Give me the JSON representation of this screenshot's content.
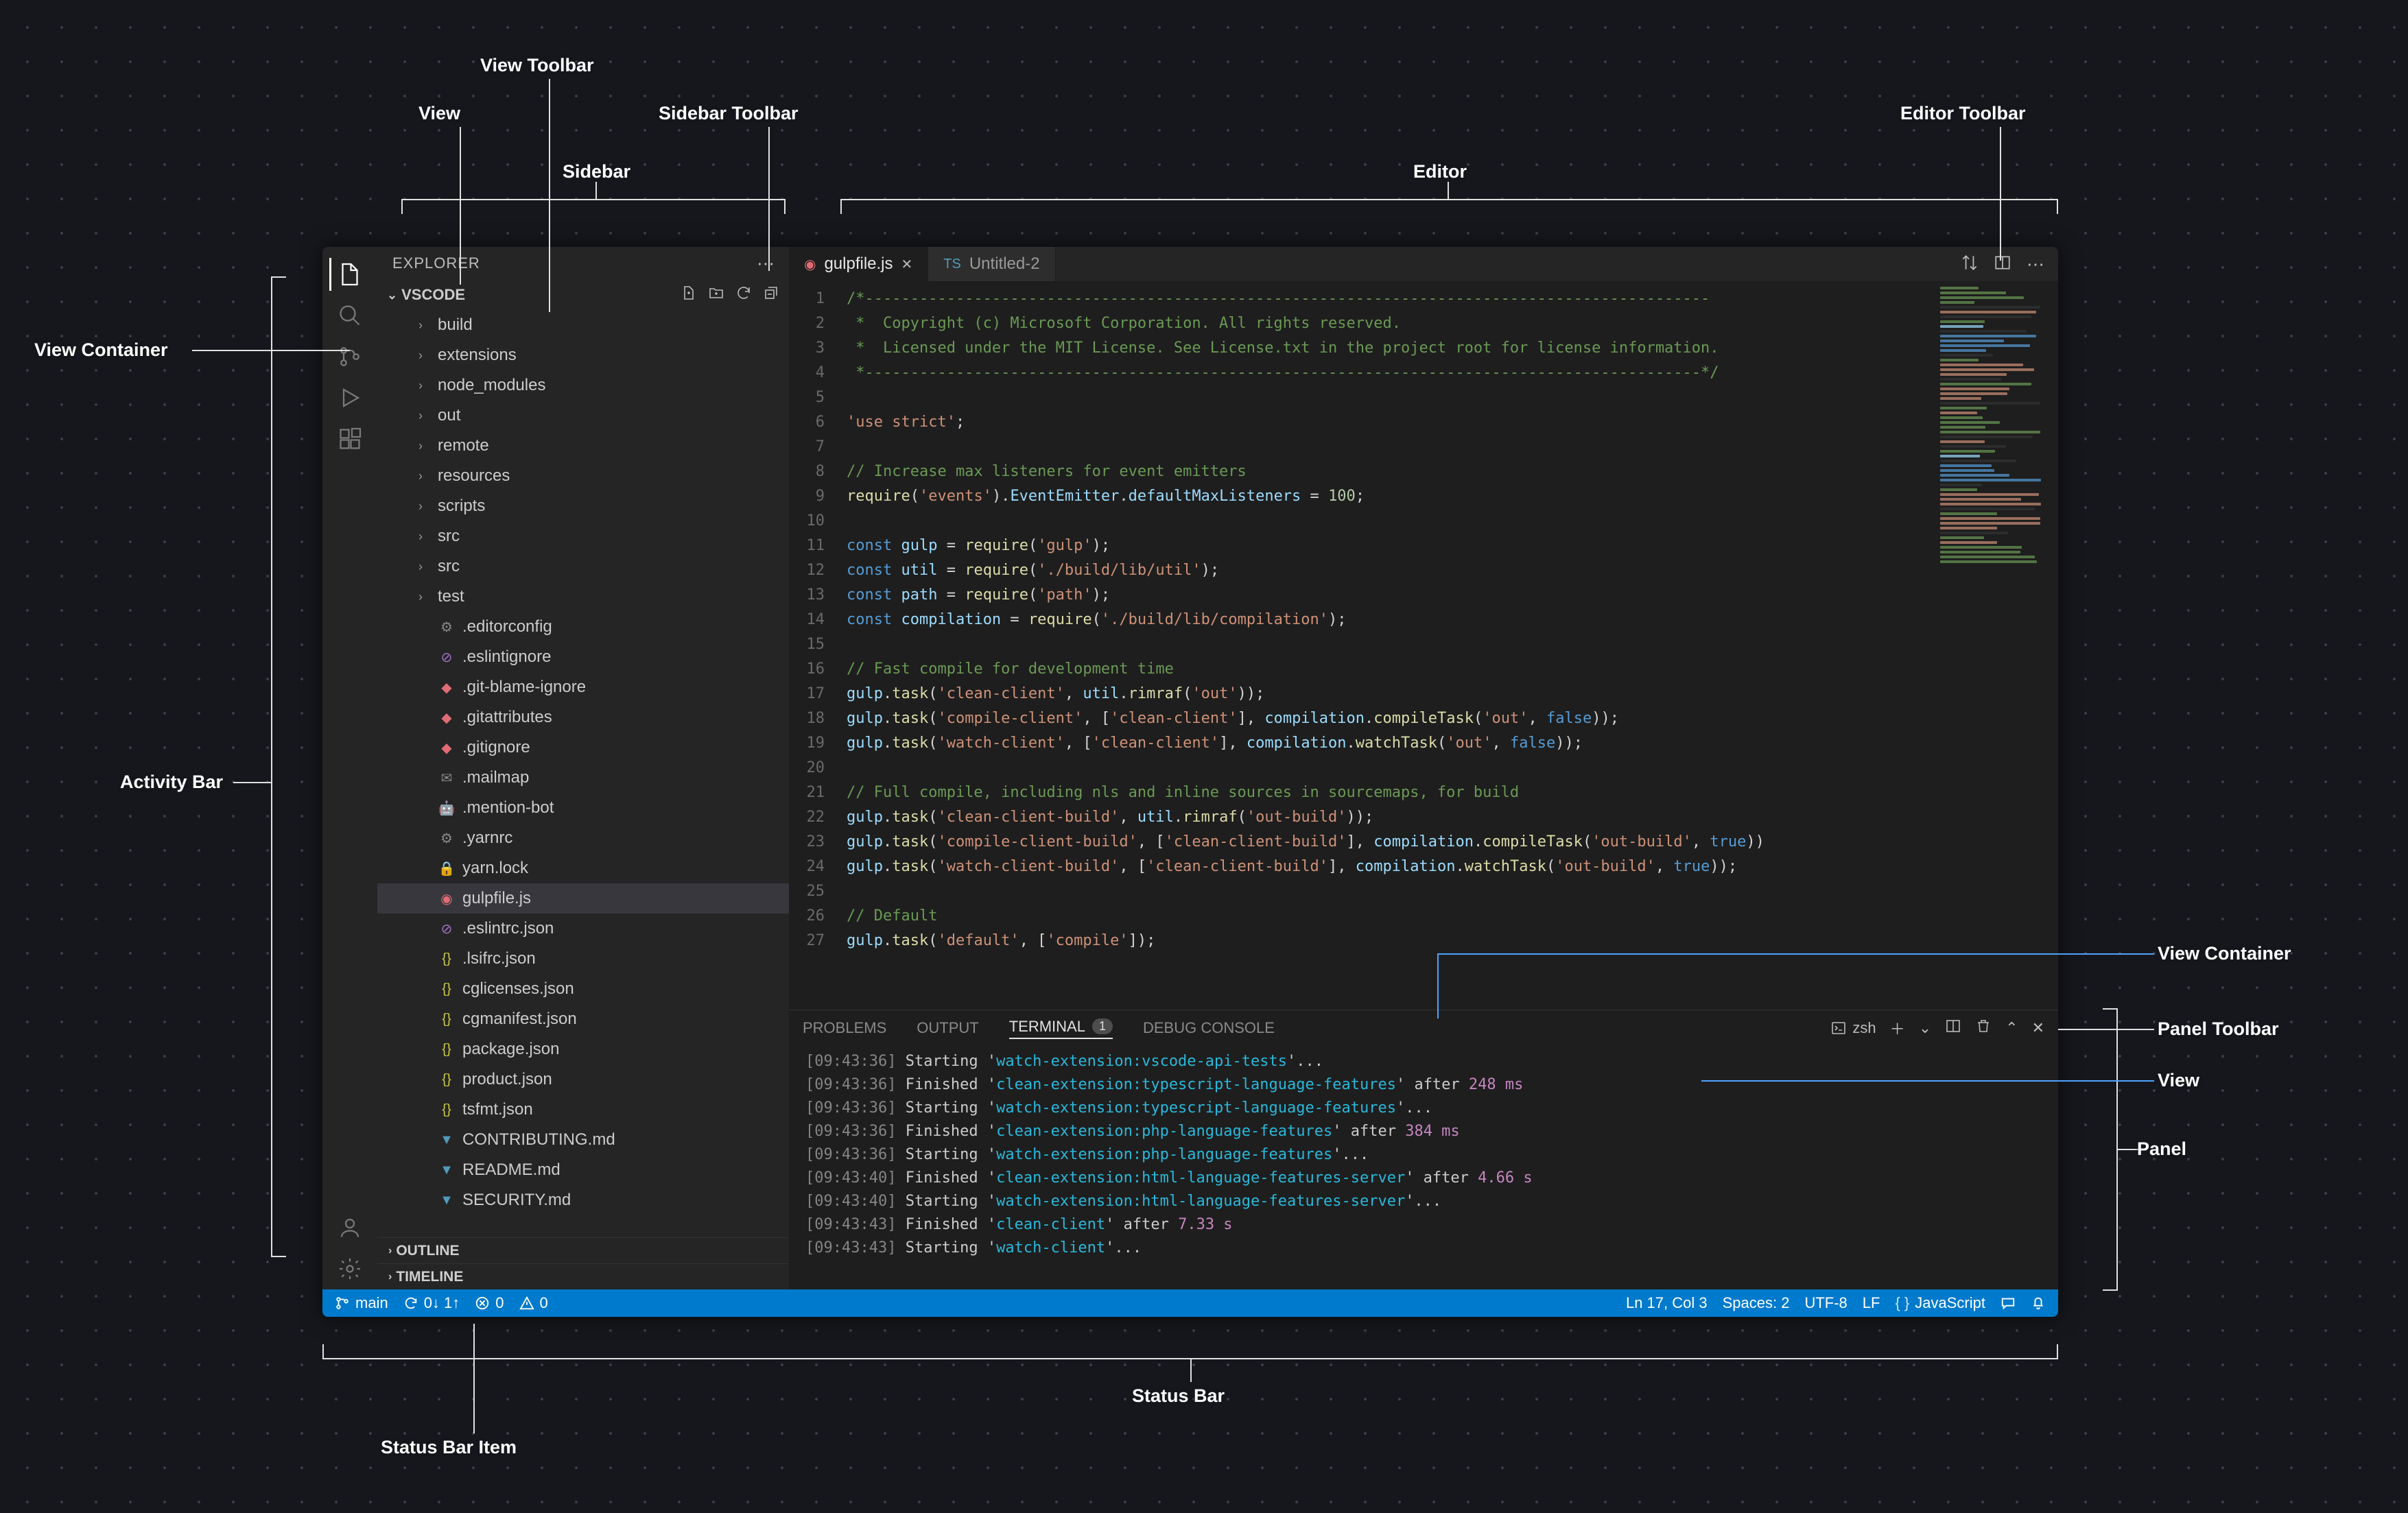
{
  "annotations": {
    "view_toolbar": "View Toolbar",
    "view": "View",
    "sidebar_toolbar": "Sidebar Toolbar",
    "sidebar": "Sidebar",
    "editor": "Editor",
    "editor_toolbar": "Editor Toolbar",
    "view_container_left": "View Container",
    "activity_bar": "Activity Bar",
    "view_container_right": "View Container",
    "panel_toolbar": "Panel Toolbar",
    "view_right": "View",
    "panel": "Panel",
    "status_bar": "Status Bar",
    "status_bar_item": "Status Bar Item"
  },
  "sidebar": {
    "title": "EXPLORER",
    "section": "VSCODE",
    "tree": [
      {
        "t": "folder",
        "label": "build"
      },
      {
        "t": "folder",
        "label": "extensions"
      },
      {
        "t": "folder",
        "label": "node_modules"
      },
      {
        "t": "folder",
        "label": "out"
      },
      {
        "t": "folder",
        "label": "remote"
      },
      {
        "t": "folder",
        "label": "resources"
      },
      {
        "t": "folder",
        "label": "scripts"
      },
      {
        "t": "folder",
        "label": "src"
      },
      {
        "t": "folder",
        "label": "src"
      },
      {
        "t": "folder",
        "label": "test"
      },
      {
        "t": "file",
        "icon": "⚙",
        "cls": "ic-gray",
        "label": ".editorconfig"
      },
      {
        "t": "file",
        "icon": "⊘",
        "cls": "ic-purple",
        "label": ".eslintignore"
      },
      {
        "t": "file",
        "icon": "◆",
        "cls": "ic-red",
        "label": ".git-blame-ignore"
      },
      {
        "t": "file",
        "icon": "◆",
        "cls": "ic-red",
        "label": ".gitattributes"
      },
      {
        "t": "file",
        "icon": "◆",
        "cls": "ic-red",
        "label": ".gitignore"
      },
      {
        "t": "file",
        "icon": "✉",
        "cls": "ic-gray",
        "label": ".mailmap"
      },
      {
        "t": "file",
        "icon": "🤖",
        "cls": "ic-gray",
        "label": ".mention-bot"
      },
      {
        "t": "file",
        "icon": "⚙",
        "cls": "ic-gray",
        "label": ".yarnrc"
      },
      {
        "t": "file",
        "icon": "🔒",
        "cls": "ic-gray",
        "label": "yarn.lock"
      },
      {
        "t": "file",
        "icon": "◉",
        "cls": "ic-red",
        "label": "gulpfile.js",
        "sel": true
      },
      {
        "t": "file",
        "icon": "⊘",
        "cls": "ic-purple",
        "label": ".eslintrc.json"
      },
      {
        "t": "file",
        "icon": "{}",
        "cls": "ic-yellow",
        "label": ".lsifrc.json"
      },
      {
        "t": "file",
        "icon": "{}",
        "cls": "ic-yellow",
        "label": "cglicenses.json"
      },
      {
        "t": "file",
        "icon": "{}",
        "cls": "ic-yellow",
        "label": "cgmanifest.json"
      },
      {
        "t": "file",
        "icon": "{}",
        "cls": "ic-yellow",
        "label": "package.json"
      },
      {
        "t": "file",
        "icon": "{}",
        "cls": "ic-yellow",
        "label": "product.json"
      },
      {
        "t": "file",
        "icon": "{}",
        "cls": "ic-yellow",
        "label": "tsfmt.json"
      },
      {
        "t": "file",
        "icon": "▼",
        "cls": "ic-blue",
        "label": "CONTRIBUTING.md"
      },
      {
        "t": "file",
        "icon": "▼",
        "cls": "ic-blue",
        "label": "README.md"
      },
      {
        "t": "file",
        "icon": "▼",
        "cls": "ic-blue",
        "label": "SECURITY.md"
      }
    ],
    "outline": "OUTLINE",
    "timeline": "TIMELINE"
  },
  "tabs": [
    {
      "icon": "◉",
      "cls": "ic-red",
      "label": "gulpfile.js",
      "active": true,
      "close": true
    },
    {
      "icon": "TS",
      "cls": "ic-blue",
      "label": "Untitled-2",
      "active": false,
      "close": false
    }
  ],
  "code": {
    "lines": [
      "<span class='c-g'>/*---------------------------------------------------------------------------------------------</span>",
      "<span class='c-g'> *  Copyright (c) Microsoft Corporation. All rights reserved.</span>",
      "<span class='c-g'> *  Licensed under the MIT License. See License.txt in the project root for license information.</span>",
      "<span class='c-g'> *--------------------------------------------------------------------------------------------*/</span>",
      "",
      "<span class='c-s'>'use strict'</span>;",
      "",
      "<span class='c-g'>// Increase max listeners for event emitters</span>",
      "<span class='c-f'>require</span>(<span class='c-s'>'events'</span>).<span class='c-v'>EventEmitter</span>.<span class='c-v'>defaultMaxListeners</span> = <span class='c-n'>100</span>;",
      "",
      "<span class='c-k'>const</span> <span class='c-v'>gulp</span> = <span class='c-f'>require</span>(<span class='c-s'>'gulp'</span>);",
      "<span class='c-k'>const</span> <span class='c-v'>util</span> = <span class='c-f'>require</span>(<span class='c-s'>'./build/lib/util'</span>);",
      "<span class='c-k'>const</span> <span class='c-v'>path</span> = <span class='c-f'>require</span>(<span class='c-s'>'path'</span>);",
      "<span class='c-k'>const</span> <span class='c-v'>compilation</span> = <span class='c-f'>require</span>(<span class='c-s'>'./build/lib/compilation'</span>);",
      "",
      "<span class='c-g'>// Fast compile for development time</span>",
      "<span class='c-v'>gulp</span>.<span class='c-f'>task</span>(<span class='c-s'>'clean-client'</span>, <span class='c-v'>util</span>.<span class='c-f'>rimraf</span>(<span class='c-s'>'out'</span>));",
      "<span class='c-v'>gulp</span>.<span class='c-f'>task</span>(<span class='c-s'>'compile-client'</span>, [<span class='c-s'>'clean-client'</span>], <span class='c-v'>compilation</span>.<span class='c-f'>compileTask</span>(<span class='c-s'>'out'</span>, <span class='c-k'>false</span>));",
      "<span class='c-v'>gulp</span>.<span class='c-f'>task</span>(<span class='c-s'>'watch-client'</span>, [<span class='c-s'>'clean-client'</span>], <span class='c-v'>compilation</span>.<span class='c-f'>watchTask</span>(<span class='c-s'>'out'</span>, <span class='c-k'>false</span>));",
      "",
      "<span class='c-g'>// Full compile, including nls and inline sources in sourcemaps, for build</span>",
      "<span class='c-v'>gulp</span>.<span class='c-f'>task</span>(<span class='c-s'>'clean-client-build'</span>, <span class='c-v'>util</span>.<span class='c-f'>rimraf</span>(<span class='c-s'>'out-build'</span>));",
      "<span class='c-v'>gulp</span>.<span class='c-f'>task</span>(<span class='c-s'>'compile-client-build'</span>, [<span class='c-s'>'clean-client-build'</span>], <span class='c-v'>compilation</span>.<span class='c-f'>compileTask</span>(<span class='c-s'>'out-build'</span>, <span class='c-k'>true</span>))",
      "<span class='c-v'>gulp</span>.<span class='c-f'>task</span>(<span class='c-s'>'watch-client-build'</span>, [<span class='c-s'>'clean-client-build'</span>], <span class='c-v'>compilation</span>.<span class='c-f'>watchTask</span>(<span class='c-s'>'out-build'</span>, <span class='c-k'>true</span>));",
      "",
      "<span class='c-g'>// Default</span>",
      "<span class='c-v'>gulp</span>.<span class='c-f'>task</span>(<span class='c-s'>'default'</span>, [<span class='c-s'>'compile'</span>]);"
    ]
  },
  "panel": {
    "tabs": {
      "problems": "PROBLEMS",
      "output": "OUTPUT",
      "terminal": "TERMINAL",
      "debug": "DEBUG CONSOLE",
      "badge": "1"
    },
    "shell": "zsh",
    "lines": [
      "<span class='t-gray'>[09:43:36]</span> Starting '<span class='t-cyan'>watch-extension:vscode-api-tests</span>'...",
      "<span class='t-gray'>[09:43:36]</span> Finished '<span class='t-cyan'>clean-extension:typescript-language-features</span>' after <span class='t-mag'>248 ms</span>",
      "<span class='t-gray'>[09:43:36]</span> Starting '<span class='t-cyan'>watch-extension:typescript-language-features</span>'...",
      "<span class='t-gray'>[09:43:36]</span> Finished '<span class='t-cyan'>clean-extension:php-language-features</span>' after <span class='t-mag'>384 ms</span>",
      "<span class='t-gray'>[09:43:36]</span> Starting '<span class='t-cyan'>watch-extension:php-language-features</span>'...",
      "<span class='t-gray'>[09:43:40]</span> Finished '<span class='t-cyan'>clean-extension:html-language-features-server</span>' after <span class='t-mag'>4.66 s</span>",
      "<span class='t-gray'>[09:43:40]</span> Starting '<span class='t-cyan'>watch-extension:html-language-features-server</span>'...",
      "<span class='t-gray'>[09:43:43]</span> Finished '<span class='t-cyan'>clean-client</span>' after <span class='t-mag'>7.33 s</span>",
      "<span class='t-gray'>[09:43:43]</span> Starting '<span class='t-cyan'>watch-client</span>'..."
    ]
  },
  "status": {
    "branch": "main",
    "sync": "0↓ 1↑",
    "errors": "0",
    "warnings": "0",
    "pos": "Ln 17, Col 3",
    "spaces": "Spaces: 2",
    "enc": "UTF-8",
    "eol": "LF",
    "lang": "JavaScript"
  }
}
